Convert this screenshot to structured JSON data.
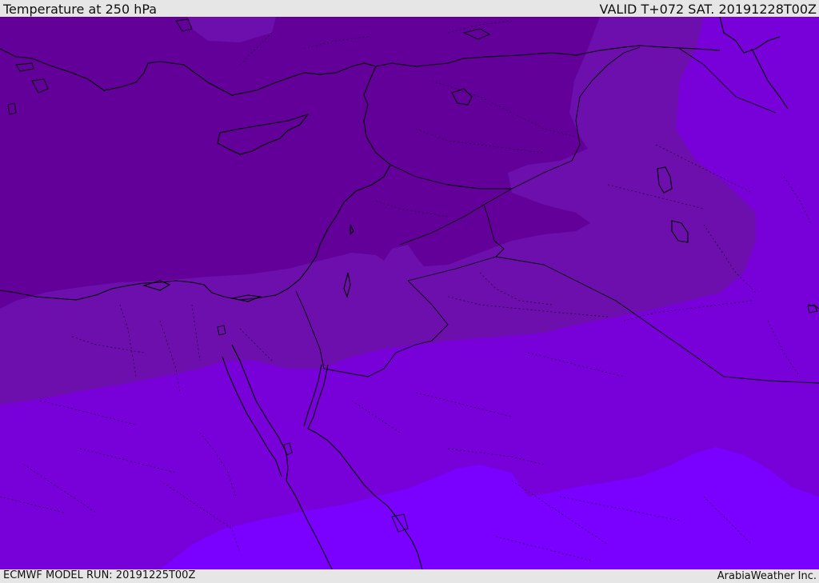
{
  "header": {
    "title": "Temperature at 250 hPa",
    "valid_time": "VALID T+072 SAT. 20191228T00Z"
  },
  "footer": {
    "model_run": "ECMWF MODEL RUN: 20191225T00Z",
    "credit": "ArabiaWeather Inc."
  },
  "map": {
    "variable": "temperature",
    "level": "250 hPa",
    "shading_colors": {
      "darkest": "#620099",
      "dark": "#6c0fad",
      "mid": "#7800d8",
      "light": "#7a00ff"
    },
    "coastline_color": "#000000",
    "border_style": "dotted"
  }
}
